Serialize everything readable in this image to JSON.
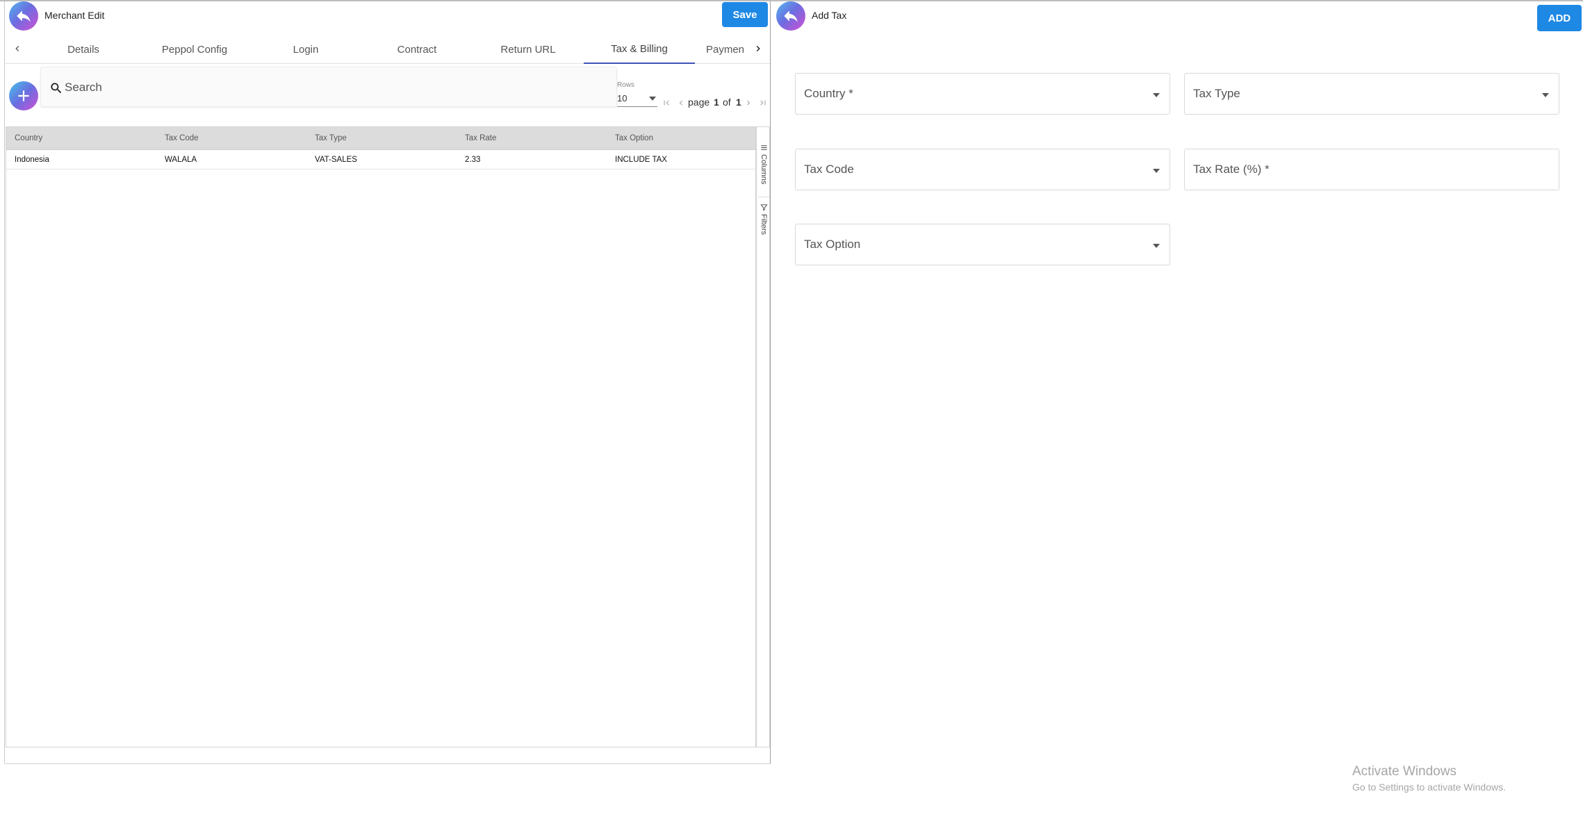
{
  "merchant_panel": {
    "title": "Merchant Edit",
    "save_label": "Save",
    "tabs": [
      {
        "label": "Details"
      },
      {
        "label": "Peppol Config"
      },
      {
        "label": "Login"
      },
      {
        "label": "Contract"
      },
      {
        "label": "Return URL"
      },
      {
        "label": "Tax & Billing",
        "active": true
      },
      {
        "label": "Payment"
      }
    ],
    "search": {
      "placeholder": "Search",
      "value": ""
    },
    "pagination": {
      "rows_label": "Rows",
      "rows_value": "10",
      "page_word": "page",
      "current_page": "1",
      "of_word": "of",
      "total_pages": "1"
    },
    "grid": {
      "columns": [
        "Country",
        "Tax Code",
        "Tax Type",
        "Tax Rate",
        "Tax Option"
      ],
      "rows": [
        [
          "Indonesia",
          "WALALA",
          "VAT-SALES",
          "2.33",
          "INCLUDE TAX"
        ]
      ]
    },
    "side_panel": {
      "columns_label": "Columns",
      "filters_label": "Filters"
    }
  },
  "add_tax_panel": {
    "title": "Add Tax",
    "add_label": "ADD",
    "fields": {
      "country": "Country *",
      "tax_type": "Tax Type",
      "tax_code": "Tax Code",
      "tax_rate": "Tax Rate (%) *",
      "tax_option": "Tax Option"
    }
  },
  "watermark": {
    "line1": "Activate Windows",
    "line2": "Go to Settings to activate Windows."
  },
  "colors": {
    "primary_button": "#1e88e5",
    "active_tab_underline": "#3f51b5",
    "grid_header_bg": "#dcdcdc"
  },
  "icons": [
    "back-arrow-icon",
    "plus-icon",
    "search-icon",
    "chevron-left-icon",
    "chevron-right-icon",
    "first-page-icon",
    "last-page-icon",
    "columns-icon",
    "filter-icon",
    "dropdown-caret-icon"
  ]
}
